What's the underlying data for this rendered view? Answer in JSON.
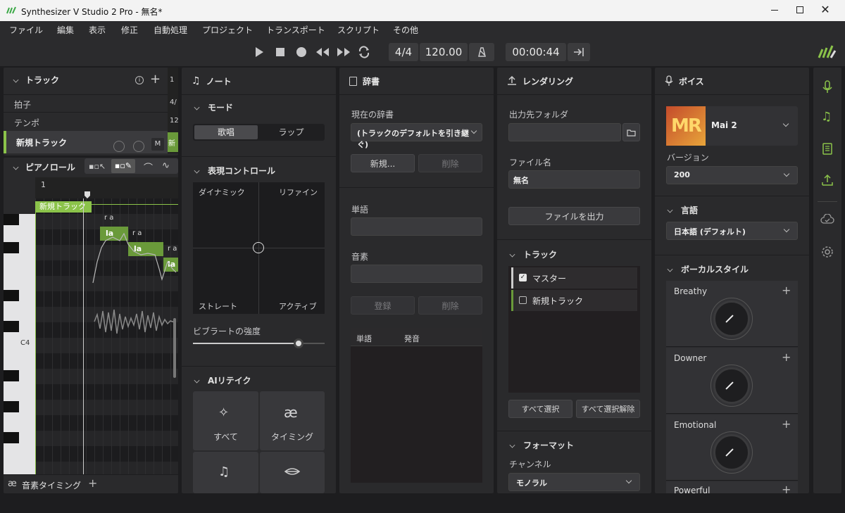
{
  "window": {
    "title": "Synthesizer V Studio 2 Pro - 無名*"
  },
  "menu": [
    "ファイル",
    "編集",
    "表示",
    "修正",
    "自動処理",
    "プロジェクト",
    "トランスポート",
    "スクリプト",
    "その他"
  ],
  "transport": {
    "time_signature": "4/4",
    "tempo": "120.00",
    "time": "00:00:44"
  },
  "track_panel": {
    "title": "トラック",
    "rows": [
      "拍子",
      "テンポ"
    ],
    "track_name": "新規トラック",
    "track_mini_labels": [
      "4/",
      "12",
      "新"
    ],
    "ruler_start": "1",
    "mute_label": "M"
  },
  "piano_roll": {
    "title": "ピアノロール",
    "measure": "1",
    "track_label": "新規トラック",
    "c4_label": "C4",
    "notes": [
      {
        "lyric": "la",
        "phoneme": "r a"
      },
      {
        "lyric": "la",
        "phoneme": "r a"
      },
      {
        "lyric": "la",
        "phoneme": "r a"
      }
    ],
    "bottom_tab": "音素タイミング",
    "bottom_tab_icon": "ae-ligature-icon"
  },
  "note_panel": {
    "title": "ノート",
    "mode_section": "モード",
    "mode_options": [
      "歌唱",
      "ラップ"
    ],
    "expression_section": "表現コントロール",
    "xy_corners": [
      "ダイナミック",
      "リファイン",
      "ストレート",
      "アクティブ"
    ],
    "vibrato_label": "ビブラートの強度",
    "vibrato_value": 0.8,
    "retake_section": "AIリテイク",
    "retake_buttons": [
      "すべて",
      "タイミング",
      "",
      ""
    ]
  },
  "dict_panel": {
    "title": "辞書",
    "current_label": "現在の辞書",
    "current_value": "(トラックのデフォルトを引き継ぐ)",
    "new_btn": "新規...",
    "delete_btn": "削除",
    "word_label": "単語",
    "phoneme_label": "音素",
    "register_btn": "登録",
    "delete_btn2": "削除",
    "table_headers": [
      "単語",
      "発音"
    ]
  },
  "render_panel": {
    "title": "レンダリング",
    "folder_label": "出力先フォルダ",
    "folder_value": "",
    "filename_label": "ファイル名",
    "filename_value": "無名",
    "export_btn": "ファイルを出力",
    "track_section": "トラック",
    "tracks": [
      {
        "name": "マスター",
        "checked": true
      },
      {
        "name": "新規トラック",
        "checked": false
      }
    ],
    "select_all": "すべて選択",
    "deselect_all": "すべて選択解除",
    "format_section": "フォーマット",
    "channel_label": "チャンネル",
    "channel_value": "モノラル"
  },
  "voice_panel": {
    "title": "ボイス",
    "voice_name": "Mai 2",
    "voice_logo_text": "MR",
    "version_label": "バージョン",
    "version_value": "200",
    "language_section": "言語",
    "language_value": "日本語 (デフォルト)",
    "vocal_style_section": "ボーカルスタイル",
    "styles": [
      "Breathy",
      "Downer",
      "Emotional",
      "Powerful"
    ]
  },
  "colors": {
    "accent": "#8bc34a",
    "note_green": "#6a9a3a",
    "panel": "#2a2a2c",
    "bg": "#1d1d1f"
  }
}
